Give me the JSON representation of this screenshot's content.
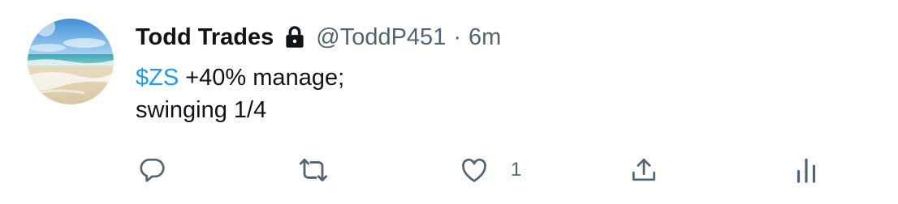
{
  "tweet": {
    "display_name": "Todd Trades",
    "protected_icon": "lock-icon",
    "handle": "@ToddP451",
    "separator": "·",
    "time": "6m",
    "avatar": "beach-ocean-photo",
    "text": {
      "cashtag": "$ZS",
      "line1_rest": " +40% manage;",
      "line2": "swinging 1/4"
    },
    "actions": {
      "reply": {
        "icon": "reply-icon",
        "count": ""
      },
      "retweet": {
        "icon": "retweet-icon",
        "count": ""
      },
      "like": {
        "icon": "heart-icon",
        "count": "1"
      },
      "share": {
        "icon": "share-icon",
        "count": ""
      },
      "analytics": {
        "icon": "analytics-icon",
        "count": ""
      }
    }
  },
  "colors": {
    "text_primary": "#0f1419",
    "text_secondary": "#536471",
    "link": "#1d9bf0",
    "background": "#ffffff"
  }
}
